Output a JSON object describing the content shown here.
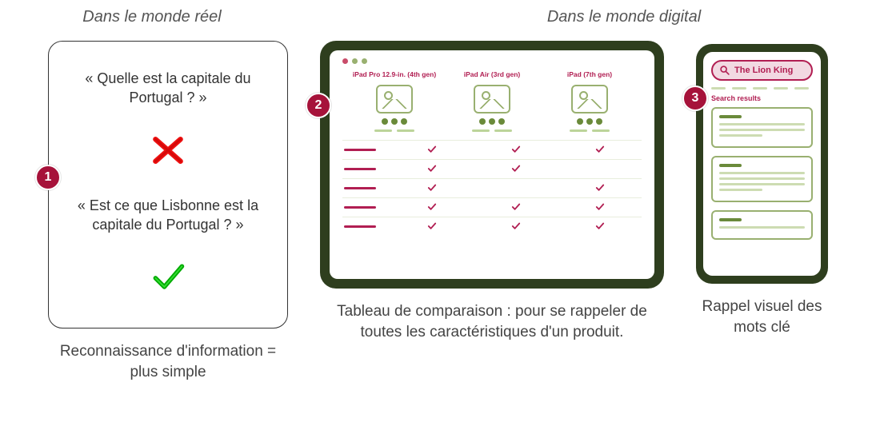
{
  "headings": {
    "left": "Dans le monde réel",
    "right": "Dans le monde digital"
  },
  "panel1": {
    "badge": "1",
    "question_a": "« Quelle est la capitale du Portugal ? »",
    "question_b": "« Est ce que Lisbonne est la capitale du Portugal ? »",
    "caption": "Reconnaissance d'information = plus simple"
  },
  "panel2": {
    "badge": "2",
    "columns": [
      {
        "name": "iPad Pro 12.9-in. (4th gen)"
      },
      {
        "name": "iPad Air (3rd gen)"
      },
      {
        "name": "iPad (7th gen)"
      }
    ],
    "rows_checks": [
      [
        true,
        true,
        true
      ],
      [
        true,
        true,
        false
      ],
      [
        true,
        false,
        true
      ],
      [
        true,
        true,
        true
      ],
      [
        true,
        true,
        true
      ]
    ],
    "caption": "Tableau de comparaison : pour se rappeler de toutes les caractéristiques d'un produit."
  },
  "panel3": {
    "badge": "3",
    "search_query": "The Lion King",
    "results_label": "Search results",
    "caption": "Rappel visuel des mots clé"
  }
}
